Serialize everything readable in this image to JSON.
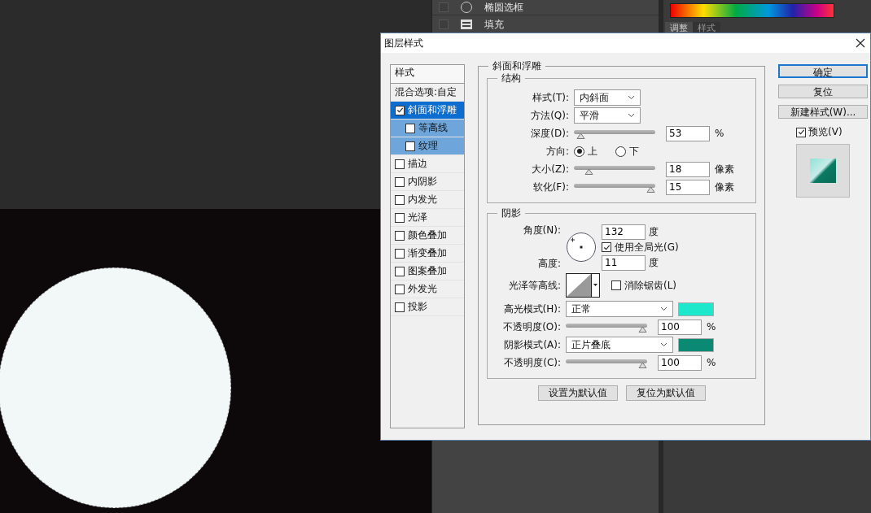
{
  "layers_panel": {
    "layers": [
      {
        "name": "椭圆选框",
        "visible": false
      },
      {
        "name": "填充",
        "visible": false
      }
    ]
  },
  "right_panel": {
    "tabs": [
      {
        "label": "调整",
        "selected": true
      },
      {
        "label": "样式",
        "selected": false
      }
    ]
  },
  "dialog": {
    "title": "图层样式",
    "style_list": {
      "header": "样式",
      "blend_options": "混合选项:自定",
      "items": [
        {
          "label": "斜面和浮雕",
          "checked": true,
          "selected": true,
          "children": [
            {
              "label": "等高线",
              "checked": false
            },
            {
              "label": "纹理",
              "checked": false
            }
          ]
        },
        {
          "label": "描边",
          "checked": false,
          "selected": false
        },
        {
          "label": "内阴影",
          "checked": false,
          "selected": false
        },
        {
          "label": "内发光",
          "checked": false,
          "selected": false
        },
        {
          "label": "光泽",
          "checked": false,
          "selected": false
        },
        {
          "label": "颜色叠加",
          "checked": false,
          "selected": false
        },
        {
          "label": "渐变叠加",
          "checked": false,
          "selected": false
        },
        {
          "label": "图案叠加",
          "checked": false,
          "selected": false
        },
        {
          "label": "外发光",
          "checked": false,
          "selected": false
        },
        {
          "label": "投影",
          "checked": false,
          "selected": false
        }
      ]
    },
    "bevel": {
      "title": "斜面和浮雕",
      "structure": {
        "title": "结构",
        "style": {
          "label": "样式(T):",
          "value": "内斜面"
        },
        "technique": {
          "label": "方法(Q):",
          "value": "平滑"
        },
        "depth": {
          "label": "深度(D):",
          "level": 0.03,
          "value": "53",
          "unit": "%"
        },
        "direction": {
          "label": "方向:",
          "options": [
            {
              "label": "上",
              "selected": true
            },
            {
              "label": "下",
              "selected": false
            }
          ]
        },
        "size": {
          "label": "大小(Z):",
          "level": 0.14,
          "value": "18",
          "unit": "像素"
        },
        "soften": {
          "label": "软化(F):",
          "level": 0.97,
          "value": "15",
          "unit": "像素"
        }
      },
      "shading": {
        "title": "阴影",
        "angle": {
          "label": "角度(N):",
          "value": "132",
          "unit": "度"
        },
        "global_light": {
          "label": "使用全局光(G)",
          "checked": true
        },
        "altitude": {
          "label": "高度:",
          "value": "11",
          "unit": "度"
        },
        "gloss_contour": {
          "label": "光泽等高线:"
        },
        "anti_aliased": {
          "label": "消除锯齿(L)",
          "checked": false
        },
        "highlight_mode": {
          "label": "高光模式(H):",
          "value": "正常",
          "color": "#1de8cc"
        },
        "highlight_opacity": {
          "label": "不透明度(O):",
          "level": 0.97,
          "value": "100",
          "unit": "%"
        },
        "shadow_mode": {
          "label": "阴影模式(A):",
          "value": "正片叠底",
          "color": "#0a8a72"
        },
        "shadow_opacity": {
          "label": "不透明度(C):",
          "level": 0.97,
          "value": "100",
          "unit": "%"
        }
      },
      "default_buttons": [
        "设置为默认值",
        "复位为默认值"
      ]
    },
    "buttons": [
      {
        "label": "确定",
        "kind": "primary"
      },
      {
        "label": "复位",
        "kind": "normal"
      },
      {
        "label": "新建样式(W)...",
        "kind": "normal"
      }
    ],
    "preview": {
      "label": "预览(V)",
      "checked": true
    }
  }
}
